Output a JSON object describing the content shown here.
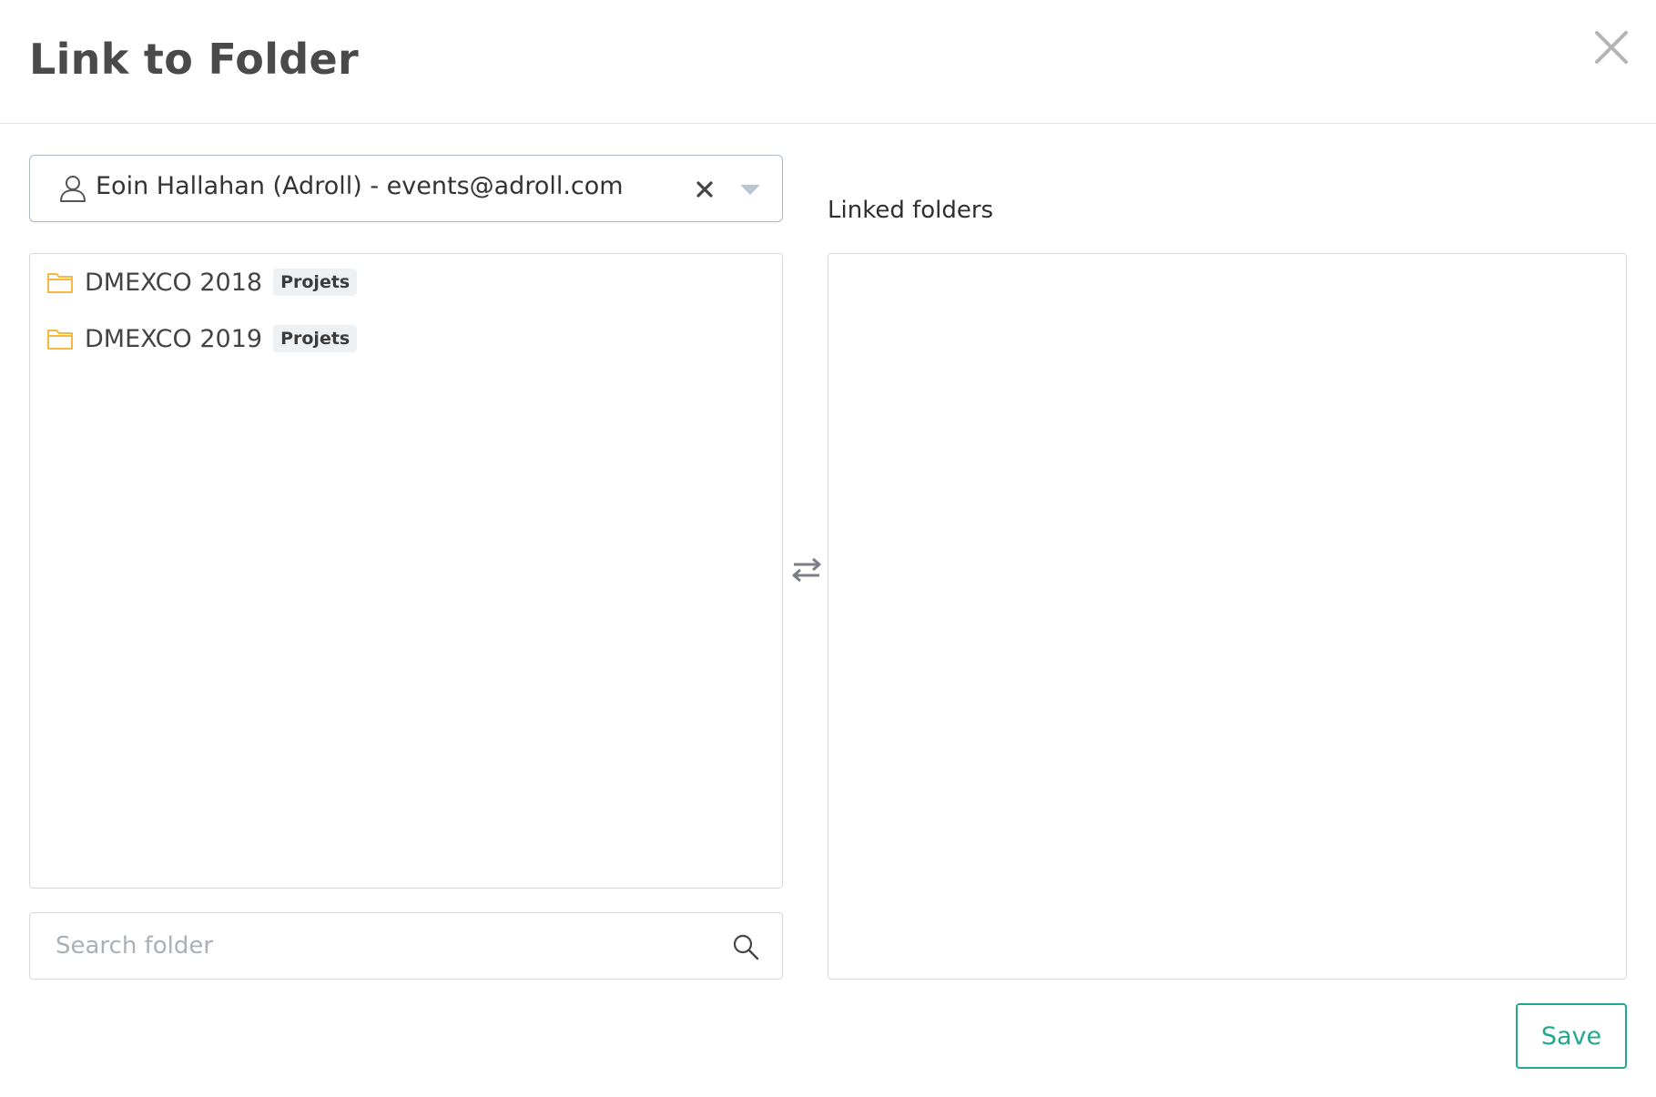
{
  "modal": {
    "title": "Link to Folder"
  },
  "user_select": {
    "selected": "Eoin Hallahan (Adroll) - events@adroll.com"
  },
  "folders": [
    {
      "name": "DMEXCO 2018",
      "tag": "Projets"
    },
    {
      "name": "DMEXCO 2019",
      "tag": "Projets"
    }
  ],
  "search": {
    "placeholder": "Search folder",
    "value": ""
  },
  "linked": {
    "label": "Linked folders"
  },
  "footer": {
    "save_label": "Save"
  },
  "colors": {
    "accent": "#1fa98f",
    "folder_icon": "#f5b942",
    "title_text": "#4a4a4a",
    "border": "#d5d9de"
  }
}
